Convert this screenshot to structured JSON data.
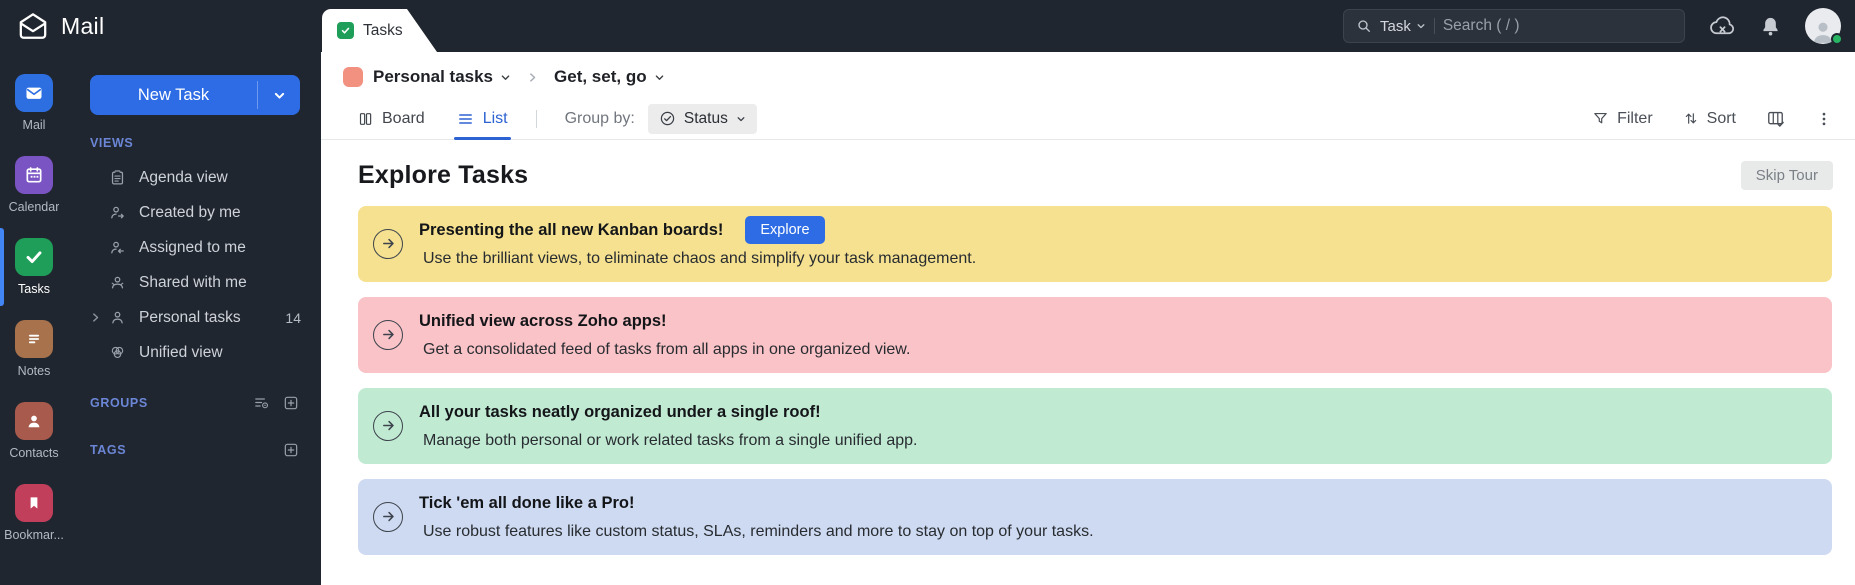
{
  "topbar": {
    "app_title": "Mail",
    "search": {
      "scope": "Task",
      "placeholder": "Search ( / )"
    }
  },
  "rail": {
    "items": [
      {
        "label": "Mail",
        "icon": "mail-icon",
        "color": "#2d6fe0"
      },
      {
        "label": "Calendar",
        "icon": "calendar-icon",
        "color": "#7b54c4"
      },
      {
        "label": "Tasks",
        "icon": "tasks-icon",
        "color": "#1e9e58",
        "active": true
      },
      {
        "label": "Notes",
        "icon": "notes-icon",
        "color": "#a8724c"
      },
      {
        "label": "Contacts",
        "icon": "contacts-icon",
        "color": "#a85a4c"
      },
      {
        "label": "Bookmar...",
        "icon": "bookmark-icon",
        "color": "#c23f5c"
      }
    ]
  },
  "sidebar": {
    "new_task_label": "New Task",
    "views_header": "VIEWS",
    "views": [
      {
        "label": "Agenda view"
      },
      {
        "label": "Created by me"
      },
      {
        "label": "Assigned to me"
      },
      {
        "label": "Shared with me"
      },
      {
        "label": "Personal tasks",
        "count": "14"
      },
      {
        "label": "Unified view"
      }
    ],
    "groups_header": "GROUPS",
    "tags_header": "TAGS"
  },
  "tab": {
    "label": "Tasks"
  },
  "breadcrumb": {
    "project": "Personal tasks",
    "section": "Get, set, go",
    "swatch_color": "#f29180"
  },
  "toolbar": {
    "board_label": "Board",
    "list_label": "List",
    "group_by_label": "Group by:",
    "group_by_value": "Status",
    "filter_label": "Filter",
    "sort_label": "Sort"
  },
  "main": {
    "heading": "Explore Tasks",
    "skip_tour_label": "Skip Tour",
    "banners": [
      {
        "title": "Presenting the all new Kanban boards!",
        "subtitle": "Use the brilliant views, to eliminate chaos and simplify your task management.",
        "button": "Explore",
        "bg": "#f5e18f"
      },
      {
        "title": "Unified view across Zoho apps!",
        "subtitle": "Get a consolidated feed of tasks from all apps in one organized view.",
        "bg": "#f9c3c7"
      },
      {
        "title": "All your tasks neatly organized under a single roof!",
        "subtitle": "Manage both personal or work related tasks from a single unified app.",
        "bg": "#c1ead3"
      },
      {
        "title": "Tick 'em all done like a Pro!",
        "subtitle": "Use robust features like custom status, SLAs, reminders and more to stay on top of your tasks.",
        "bg": "#cedaf1"
      }
    ]
  },
  "icons": {
    "sort": "↑↓",
    "kebab": "⋮",
    "chevron_down": "⌄",
    "breadcrumb_separator": "›",
    "accent_blue": "#2d6ce5",
    "active_tab_blue": "#2d62d2",
    "tasks_green": "#1e9e58"
  }
}
